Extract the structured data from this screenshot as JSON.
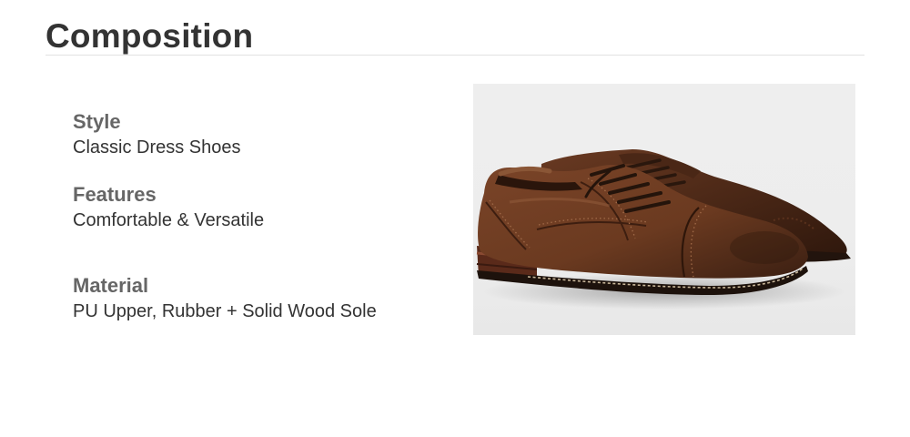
{
  "title": "Composition",
  "specs": {
    "style": {
      "label": "Style",
      "value": "Classic Dress Shoes"
    },
    "features": {
      "label": "Features",
      "value": "Comfortable & Versatile"
    },
    "material": {
      "label": "Material",
      "value": "PU Upper, Rubber + Solid Wood Sole"
    }
  },
  "colors": {
    "leather": "#6b3a20",
    "leather_dark": "#3b1f12",
    "sole": "#2a1a12",
    "background": "#eeeeee"
  }
}
